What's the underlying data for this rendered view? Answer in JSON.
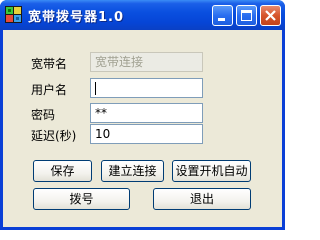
{
  "window": {
    "title": "宽带拨号器1.0",
    "app_icon": "green-grid-app-icon",
    "controls": [
      "minimize-icon",
      "maximize-icon",
      "close-icon"
    ]
  },
  "form": {
    "broadband_label": "宽带名",
    "broadband_value": "宽带连接",
    "username_label": "用户名",
    "username_value": "",
    "password_label": "密码",
    "password_value": "**",
    "delay_label": "延迟(秒)",
    "delay_value": "10"
  },
  "buttons": {
    "save": "保存",
    "create_connection": "建立连接",
    "autostart": "设置开机自动",
    "dial": "拨号",
    "exit": "退出"
  },
  "colors": {
    "titlebar": "#0a50e0",
    "client_bg": "#ece9d8",
    "close_button": "#d6552c"
  }
}
